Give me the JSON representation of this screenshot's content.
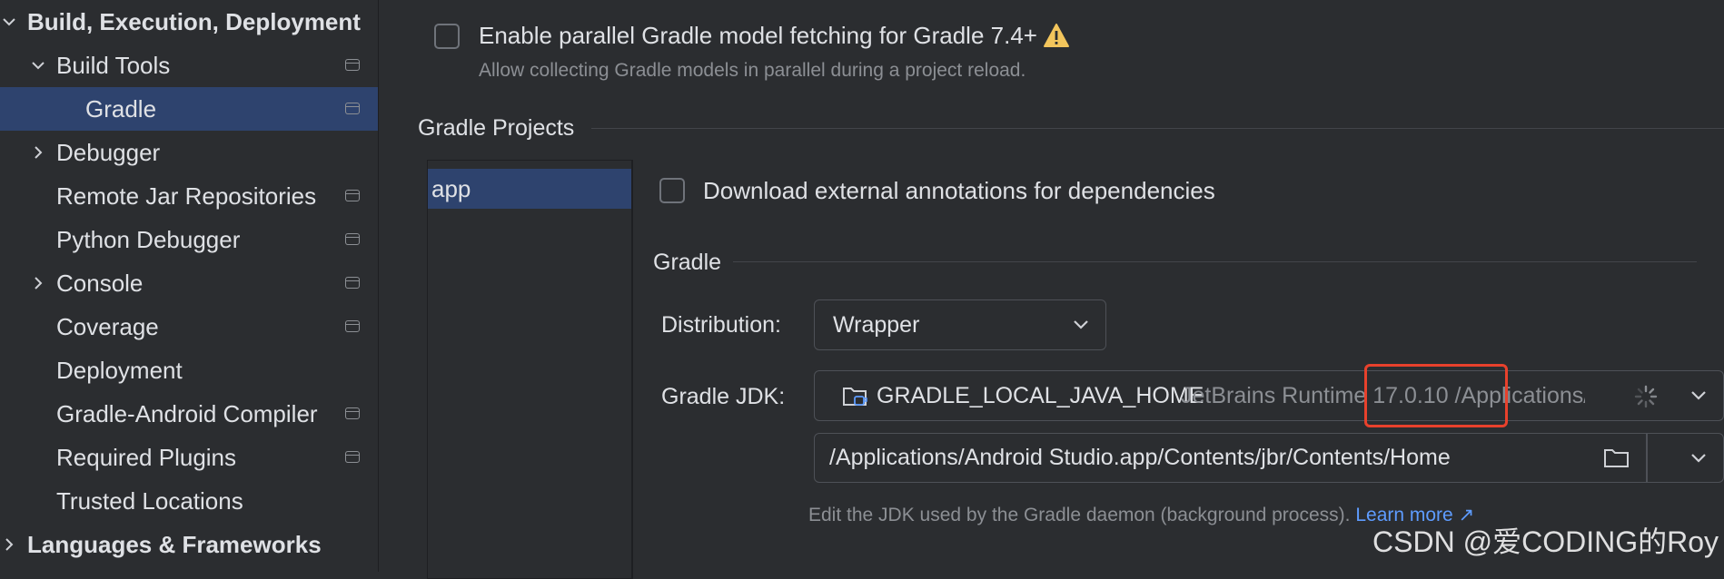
{
  "sidebar": {
    "items": [
      {
        "label": "Build, Execution, Deployment",
        "level": 0,
        "bold": true,
        "expanded": true,
        "pinned": false,
        "selected": false
      },
      {
        "label": "Build Tools",
        "level": 1,
        "expanded": true,
        "pinned": true,
        "selected": false
      },
      {
        "label": "Gradle",
        "level": 2,
        "pinned": true,
        "selected": true
      },
      {
        "label": "Debugger",
        "level": 1,
        "collapsed": true,
        "pinned": false,
        "selected": false
      },
      {
        "label": "Remote Jar Repositories",
        "level": 1,
        "pinned": true,
        "selected": false
      },
      {
        "label": "Python Debugger",
        "level": 1,
        "pinned": true,
        "selected": false
      },
      {
        "label": "Console",
        "level": 1,
        "collapsed": true,
        "pinned": true,
        "selected": false
      },
      {
        "label": "Coverage",
        "level": 1,
        "pinned": true,
        "selected": false
      },
      {
        "label": "Deployment",
        "level": 1,
        "pinned": false,
        "selected": false
      },
      {
        "label": "Gradle-Android Compiler",
        "level": 1,
        "pinned": true,
        "selected": false
      },
      {
        "label": "Required Plugins",
        "level": 1,
        "pinned": true,
        "selected": false
      },
      {
        "label": "Trusted Locations",
        "level": 1,
        "pinned": false,
        "selected": false
      },
      {
        "label": "Languages & Frameworks",
        "level": 0,
        "bold": true,
        "collapsed": true,
        "pinned": false,
        "selected": false
      }
    ]
  },
  "main": {
    "parallel": {
      "label": "Enable parallel Gradle model fetching for Gradle 7.4+",
      "hint": "Allow collecting Gradle models in parallel during a project reload.",
      "checked": false
    },
    "projects_heading": "Gradle Projects",
    "projects": [
      "app"
    ],
    "download_annotations": {
      "label": "Download external annotations for dependencies",
      "checked": false
    },
    "gradle_heading": "Gradle",
    "distribution": {
      "label": "Distribution:",
      "value": "Wrapper"
    },
    "gradle_jdk": {
      "label": "Gradle JDK:",
      "name": "GRADLE_LOCAL_JAVA_HOME",
      "details": "JetBrains Runtime 17.0.10 /Applications/"
    },
    "jdk_path": "/Applications/Android Studio.app/Contents/jbr/Contents/Home",
    "jdk_hint": "Edit the JDK used by the Gradle daemon (background process).",
    "learn_more": "Learn more ↗"
  },
  "watermark": "CSDN @爱CODING的Roy",
  "colors": {
    "background": "#2b2d30",
    "selection": "#2e436e",
    "text": "#dfe1e5",
    "muted": "#8c8f94",
    "link": "#5e9cff",
    "warning": "#f2c55c",
    "highlight_box": "#e8412c"
  }
}
